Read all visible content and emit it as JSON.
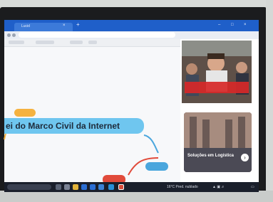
{
  "browser": {
    "tab_title": "Lucid",
    "tab_close": "×",
    "new_tab": "+",
    "controls": [
      "–",
      "□",
      "×"
    ]
  },
  "mindmap": {
    "central_topic": "ei do Marco Civil da Internet"
  },
  "ads": {
    "solutions": {
      "title": "Soluções em Logística",
      "arrow": "›"
    }
  },
  "taskbar": {
    "weather": "16°C  Pred. nublado"
  },
  "colors": {
    "central_node": "#6fc6ef",
    "orange_node": "#f5b240",
    "red_node": "#e14b3b",
    "blue_node": "#4aa6dd",
    "tab_bar": "#1f5fc9",
    "ad_caption": "#d72828"
  }
}
